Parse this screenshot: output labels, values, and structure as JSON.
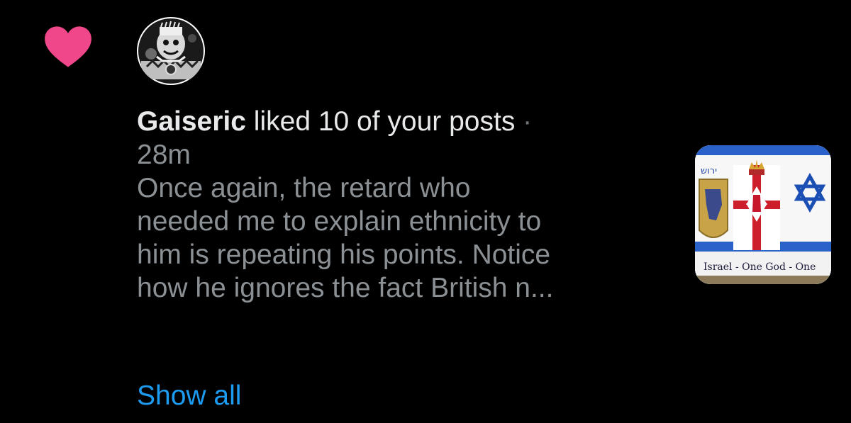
{
  "notification": {
    "username": "Gaiseric",
    "action": "liked 10 of your posts",
    "separator": " ·",
    "time": "28m",
    "preview_lines": [
      "Once again, the retard who",
      "needed me to explain ethnicity to",
      "him is repeating his points. Notice",
      "how he ignores the fact British n..."
    ],
    "show_all": "Show all",
    "thumbnail": {
      "hebrew_text": "ירוש",
      "caption": "Israel - One God - One"
    }
  },
  "icons": {
    "like": "heart-icon"
  },
  "colors": {
    "background": "#000000",
    "heart": "#f0468a",
    "primary_text": "#e7e9ea",
    "secondary_text": "#8b9095",
    "link": "#1d9bf0"
  }
}
